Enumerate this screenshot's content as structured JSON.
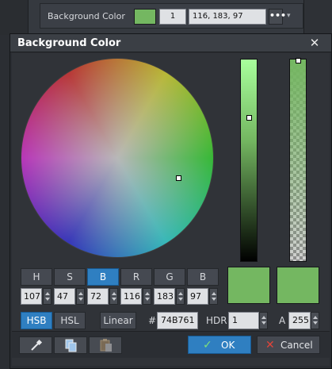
{
  "property": {
    "label": "Background Color",
    "swatch_color": "#74B761",
    "number": "1",
    "rgb_text": "116, 183, 97",
    "more_label": "•••",
    "dropdown_glyph": "▾"
  },
  "dialog": {
    "title": "Background Color",
    "close_glyph": "✕"
  },
  "channels": [
    {
      "label": "H",
      "value": "107"
    },
    {
      "label": "S",
      "value": "47"
    },
    {
      "label": "B",
      "value": "72",
      "active": true
    },
    {
      "label": "R",
      "value": "116"
    },
    {
      "label": "G",
      "value": "183"
    },
    {
      "label": "B",
      "value": "97"
    }
  ],
  "swatches": {
    "current": "#74B761",
    "previous": "#74B761"
  },
  "modes": {
    "hsb": "HSB",
    "hsl": "HSL",
    "linear": "Linear"
  },
  "hex": {
    "label": "#",
    "value": "74B761"
  },
  "hdr": {
    "label": "HDR",
    "value": "1"
  },
  "alpha": {
    "label": "A",
    "value": "255"
  },
  "buttons": {
    "ok": "OK",
    "cancel": "Cancel"
  },
  "icons": {
    "eyedropper": "eyedropper-icon",
    "copy": "copy-icon",
    "paste": "paste-icon",
    "ok_check": "checkmark-icon",
    "cancel_x": "cancel-x-icon"
  },
  "colors": {
    "accent": "#2F7FC1",
    "selected_color": "#74B761",
    "cancel_icon": "#E0443A",
    "ok_icon": "#7FE07A"
  }
}
